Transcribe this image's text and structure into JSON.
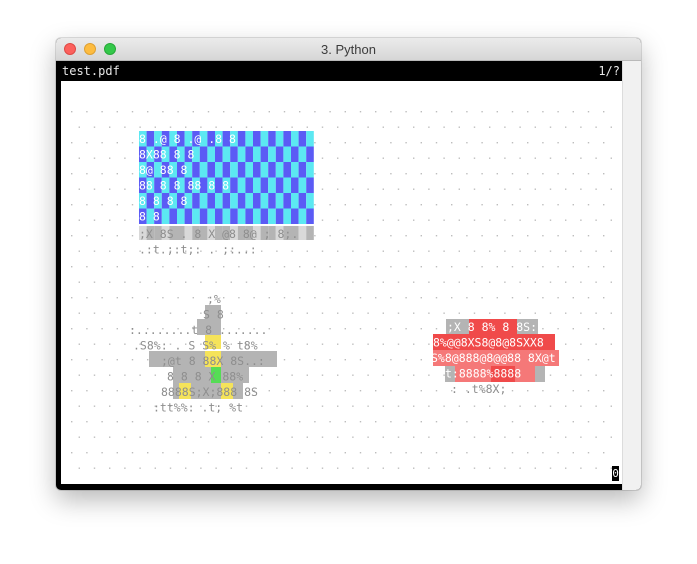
{
  "window": {
    "title": "3. Python",
    "controls": [
      "close-button",
      "minimize-button",
      "zoom-button"
    ]
  },
  "viewer": {
    "filename": "test.pdf",
    "page_indicator": "1/?",
    "cursor_char": "0"
  },
  "palette": {
    "blue": "#5b5bf5",
    "cyan": "#5ce8f2",
    "gray": "#b4b4b4",
    "yellow": "#f5e35a",
    "red": "#f04a4a",
    "coral": "#f57878",
    "green": "#55dd55",
    "dot": "#bdbdbd"
  },
  "art": {
    "blue_rows": [
      "8 .@  8 .@ .8 8",
      " 8X88    8    8",
      " 8@        88 8",
      " 88 8  8 88 8 8",
      " 8 8     8    8",
      "  8           8",
      ";X 8S  . 8 X @8 8@ ; 8;.",
      ".:t.;:t;: . ;:..:"
    ],
    "star_rows": [
      ";%",
      "S 8",
      ":........t  8  .......",
      ".S8%: . S S% %    t8%",
      ";@t 8 88X 8S..:",
      "8 8 8 X 88%",
      "8888S;X;888 8S",
      ":tt%%:  .t; %t"
    ],
    "red_rows": [
      ";X 8 8% 8 8S:",
      "8%@@8XS8@8@8SXX8",
      "S%8@888@8@@88 8X@t",
      "t:8888%8888",
      ":  .t%8X;"
    ]
  }
}
